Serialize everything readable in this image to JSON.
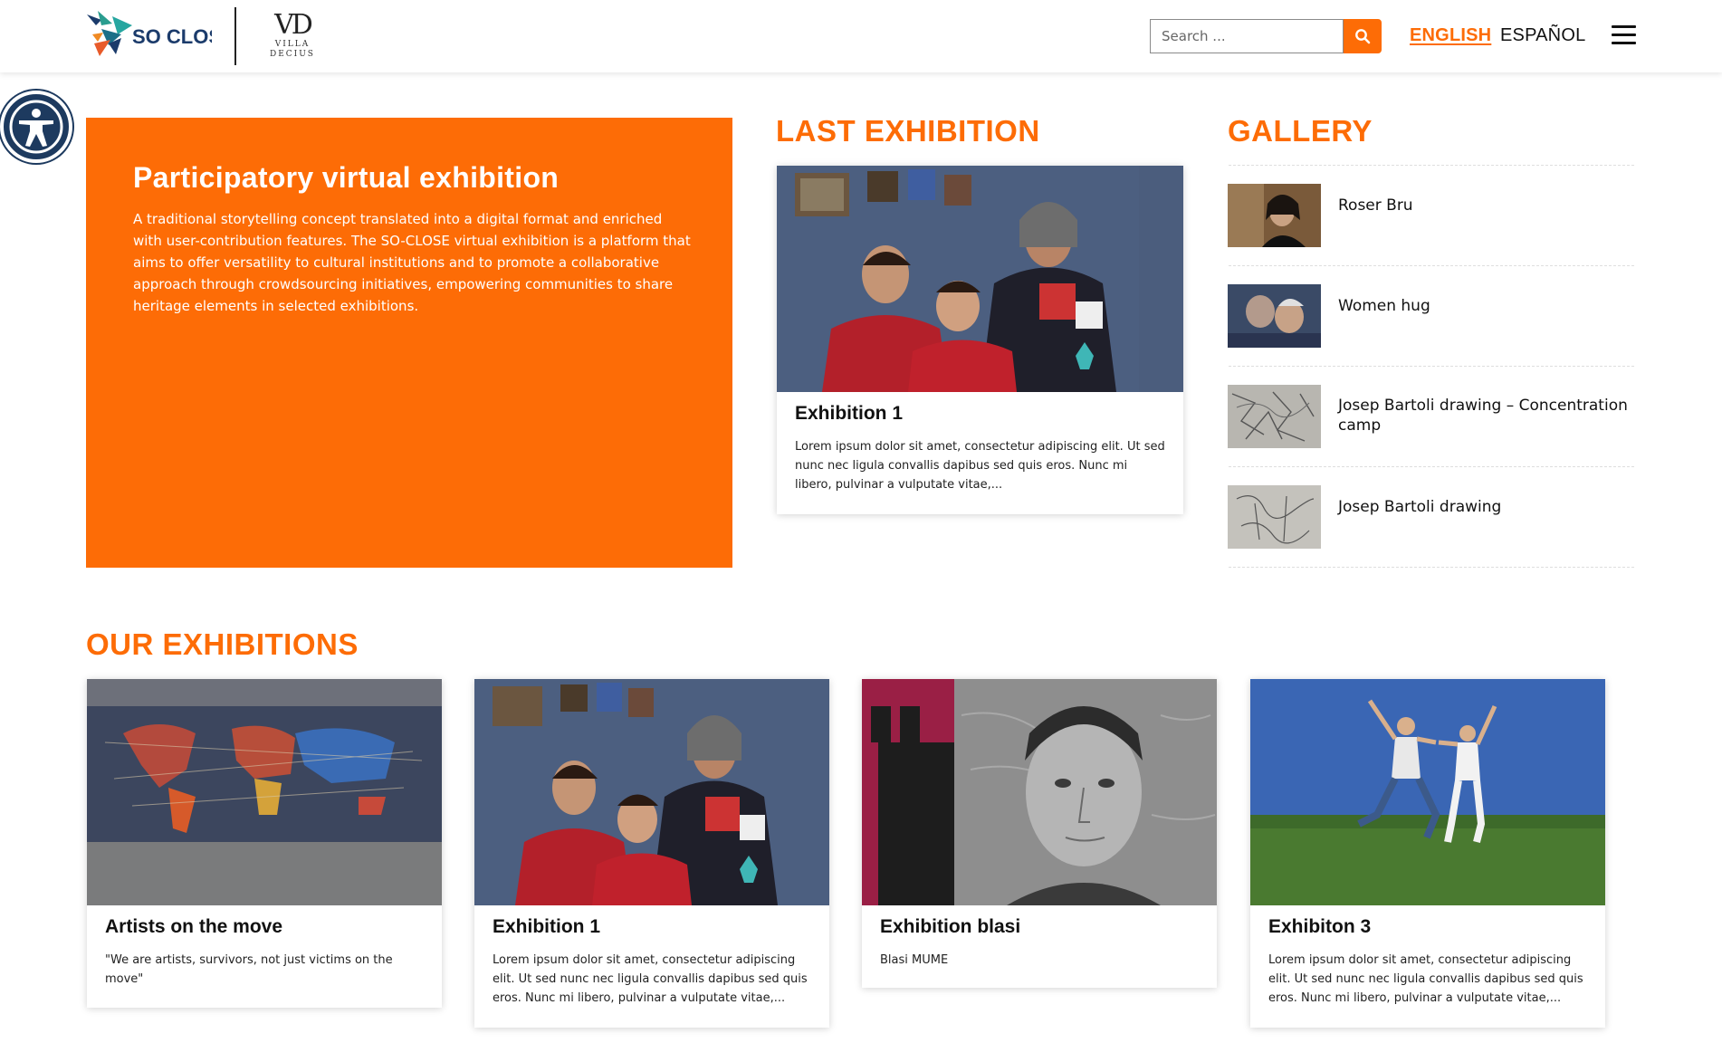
{
  "header": {
    "logo_primary": "SO CLOSE",
    "logo_secondary_mark": "VD",
    "logo_secondary_words": [
      "VILLA",
      "DECIUS"
    ],
    "search_placeholder": "Search ...",
    "search_icon": "search-icon",
    "languages": [
      {
        "label": "ENGLISH",
        "active": true
      },
      {
        "label": "ESPAÑOL",
        "active": false
      }
    ],
    "menu_icon": "hamburger-icon"
  },
  "accessibility": {
    "icon": "accessibility-icon"
  },
  "hero": {
    "title": "Participatory virtual exhibition",
    "text": "A traditional storytelling concept translated into a digital format and enriched with user-contribution features. The SO-CLOSE virtual exhibition is a platform that aims to offer versatility to cultural institutions and to promote a collaborative approach through crowdsourcing initiatives, empowering communities to share heritage elements in selected exhibitions."
  },
  "last_exhibition": {
    "heading": "LAST EXHIBITION",
    "card": {
      "title": "Exhibition 1",
      "text": "Lorem ipsum dolor sit amet, consectetur adipiscing elit. Ut sed nunc nec ligula convallis dapibus sed quis eros. Nunc mi libero, pulvinar a vulputate vitae,..."
    }
  },
  "gallery": {
    "heading": "GALLERY",
    "items": [
      {
        "label": "Roser Bru"
      },
      {
        "label": "Women hug"
      },
      {
        "label": "Josep Bartoli drawing – Concentration camp"
      },
      {
        "label": "Josep Bartoli drawing"
      }
    ]
  },
  "our_exhibitions": {
    "heading": "OUR EXHIBITIONS",
    "cards": [
      {
        "title": "Artists on the move",
        "text": "\"We are artists, survivors, not just victims on the move\""
      },
      {
        "title": "Exhibition 1",
        "text": "Lorem ipsum dolor sit amet, consectetur adipiscing elit. Ut sed nunc nec ligula convallis dapibus sed quis eros. Nunc mi libero, pulvinar a vulputate vitae,..."
      },
      {
        "title": "Exhibition blasi",
        "text": "Blasi MUME"
      },
      {
        "title": "Exhibiton 3",
        "text": "Lorem ipsum dolor sit amet, consectetur adipiscing elit. Ut sed nunc nec ligula convallis dapibus sed quis eros. Nunc mi libero, pulvinar a vulputate vitae,..."
      }
    ]
  },
  "colors": {
    "accent": "#fd6c06",
    "a11y": "#1d3a5f"
  }
}
